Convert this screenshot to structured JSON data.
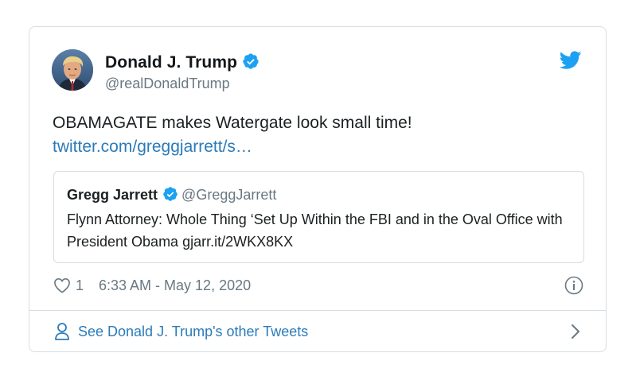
{
  "tweet": {
    "author": {
      "name": "Donald J. Trump",
      "handle": "@realDonaldTrump",
      "verified": true,
      "avatar_icon": "profile-photo"
    },
    "text": "OBAMAGATE makes Watergate look small time!",
    "link": "twitter.com/greggjarrett/s…",
    "quote": {
      "name": "Gregg Jarrett",
      "handle": "@GreggJarrett",
      "verified": true,
      "text": "Flynn Attorney: Whole Thing ‘Set Up Within the FBI and in the Oval Office with President Obama gjarr.it/2WKX8KX"
    },
    "likes": "1",
    "timestamp": "6:33 AM - May 12, 2020",
    "footer_label": "See Donald J. Trump's other Tweets"
  },
  "colors": {
    "link": "#2b7bb9",
    "verified": "#1da1f2",
    "twitter_bird": "#1da1f2",
    "muted": "#697882",
    "border": "#d6dde3"
  },
  "icons": {
    "brand": "twitter-bird-icon",
    "verified": "verified-badge-icon",
    "like": "heart-icon",
    "info": "info-icon",
    "profile": "person-icon",
    "more": "chevron-right-icon"
  }
}
